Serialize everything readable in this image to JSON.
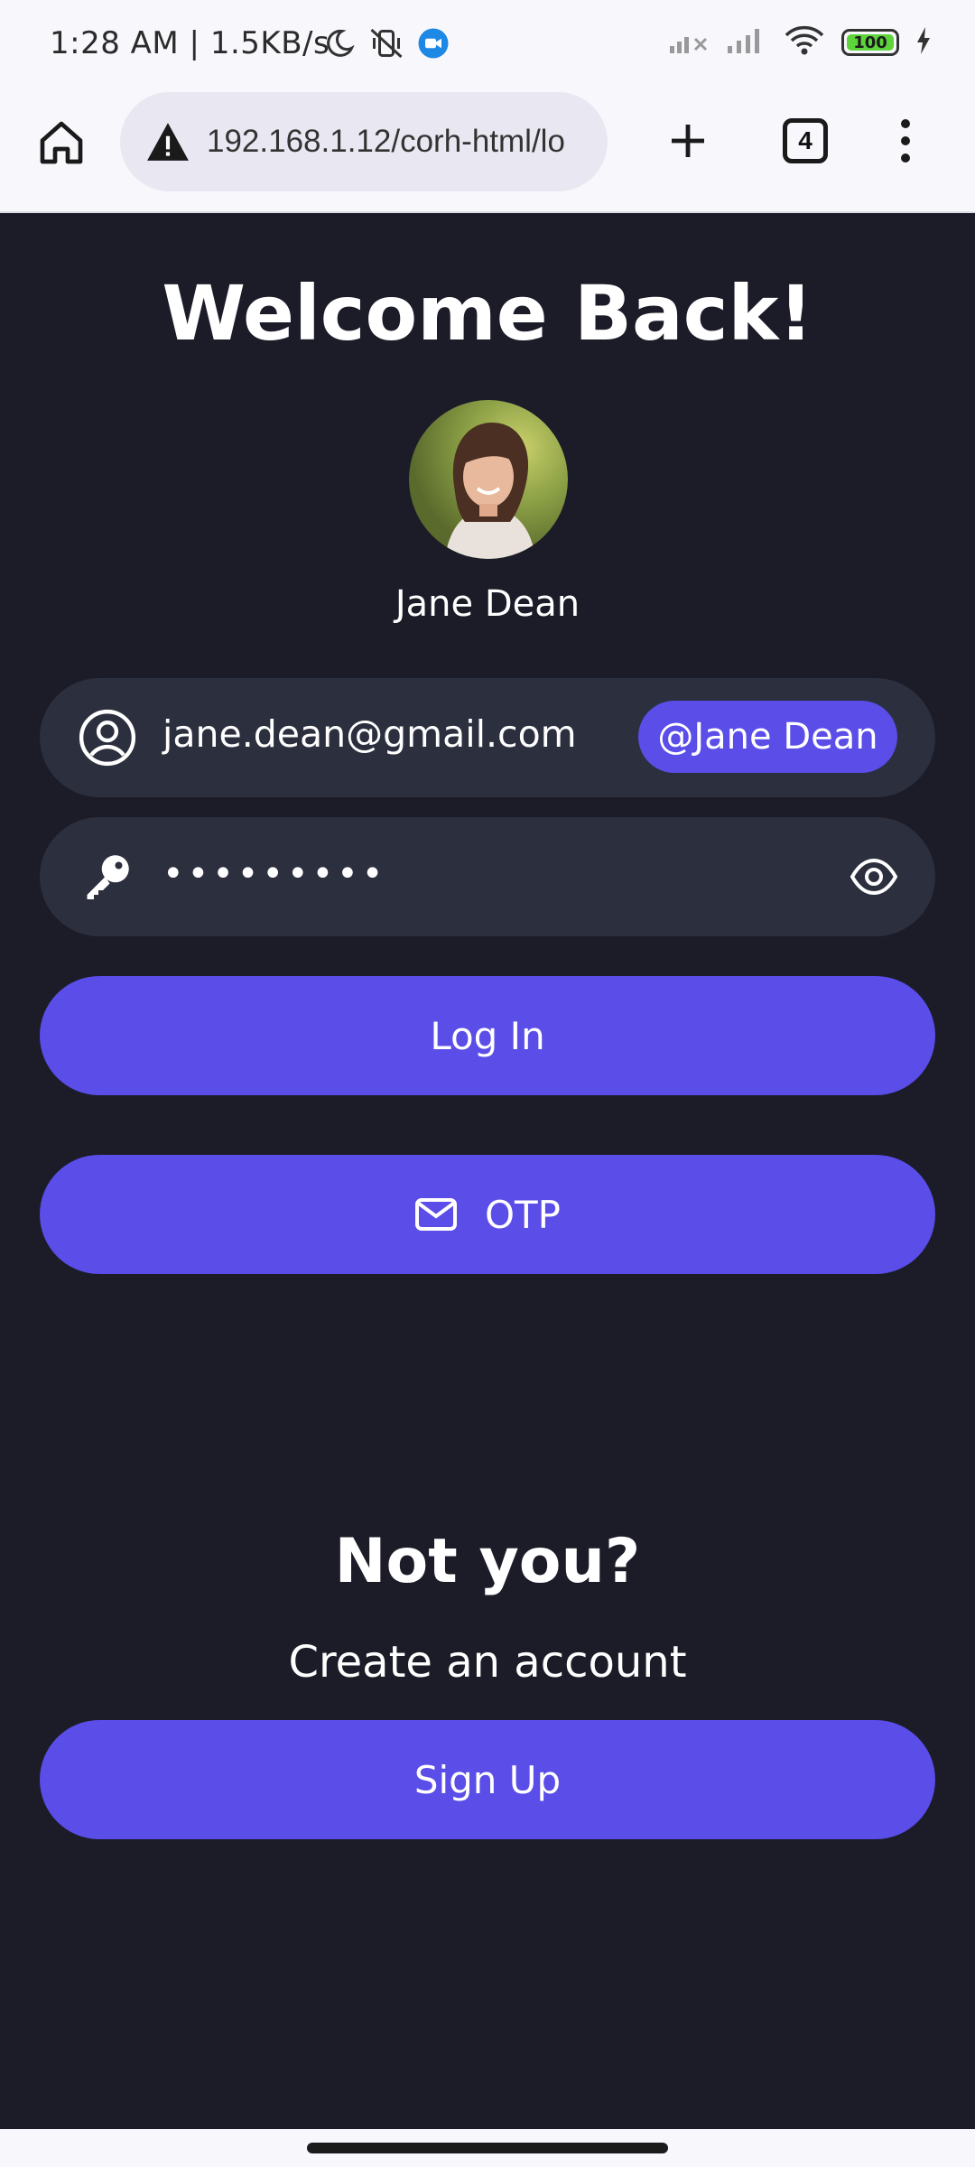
{
  "status_bar": {
    "time": "1:28 AM | 1.5KB/s",
    "battery": "100",
    "icons": [
      "moon-icon",
      "vibrate-off-icon",
      "video-call-icon",
      "signal-x-icon",
      "signal-icon",
      "wifi-icon",
      "battery-icon",
      "charging-icon"
    ]
  },
  "browser": {
    "url": "192.168.1.12/corh-html/lo",
    "tab_count": "4",
    "icons": [
      "home-icon",
      "warning-icon",
      "plus-icon",
      "more-vert-icon"
    ]
  },
  "login": {
    "title": "Welcome Back!",
    "user_name": "Jane Dean",
    "email_value": "jane.dean@gmail.com",
    "email_chip": "@Jane Dean",
    "password_value": "•••••••••",
    "login_label": "Log In",
    "otp_label": "OTP",
    "not_you": "Not you?",
    "create_account": "Create an account",
    "signup_label": "Sign Up"
  },
  "colors": {
    "background": "#1b1c28",
    "field": "#2c2f3e",
    "accent": "#5a4de8",
    "text": "#ffffff"
  }
}
